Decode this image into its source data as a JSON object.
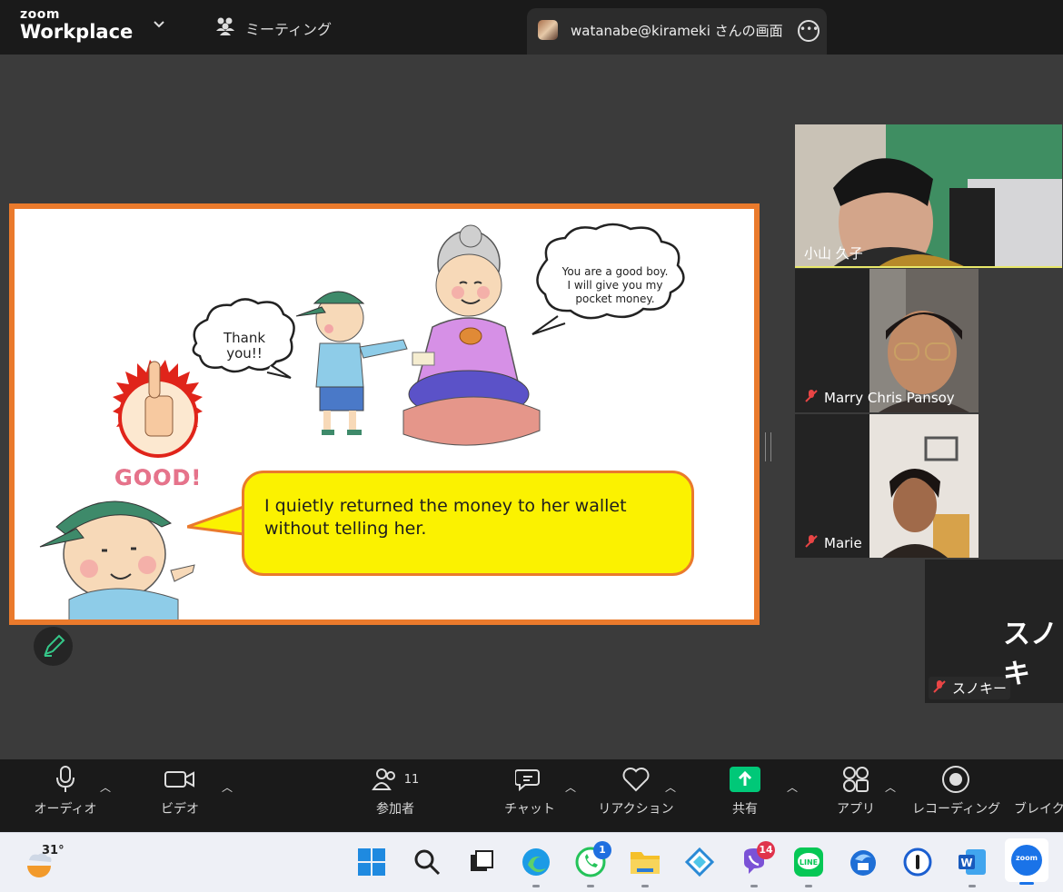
{
  "app": {
    "brand_small": "zoom",
    "brand_large": "Workplace",
    "meeting_label": "ミーティング",
    "share_tab_label": "watanabe@kirameki さんの画面"
  },
  "slide": {
    "bubble_thank": [
      "Thank",
      "you!!"
    ],
    "bubble_grandma": [
      "You are a good boy.",
      "I will give you my",
      "pocket money."
    ],
    "good_label": "GOOD!",
    "main_text": [
      "I quietly returned the money to her wallet",
      "without telling her."
    ]
  },
  "participants": [
    {
      "name": "小山 久子",
      "muted": false
    },
    {
      "name": "Marry Chris Pansoy",
      "muted": true
    },
    {
      "name": "Marie",
      "muted": true
    },
    {
      "name": "スノキー",
      "muted": true,
      "display_text": "スノキ"
    }
  ],
  "toolbar": {
    "audio": "オーディオ",
    "video": "ビデオ",
    "participants": "参加者",
    "participants_count": "11",
    "chat": "チャット",
    "reactions": "リアクション",
    "share": "共有",
    "apps": "アプリ",
    "recording": "レコーディング",
    "breakout": "ブレイク"
  },
  "taskbar": {
    "weather_temp": "31°",
    "whatsapp_badge": "1",
    "viber_badge": "14",
    "zoom_label": "zoom"
  },
  "colors": {
    "slide_border": "#ea7a2c",
    "bubble_yellow": "#fbf200",
    "share_green": "#00c878",
    "mute_red": "#e94545"
  }
}
